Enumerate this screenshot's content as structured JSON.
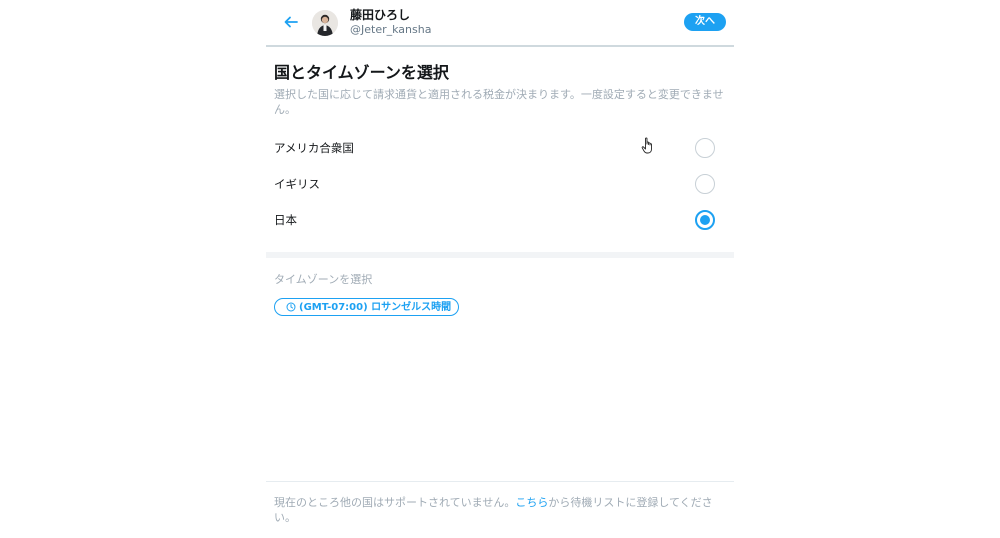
{
  "header": {
    "user_name": "藤田ひろし",
    "user_handle": "@Jeter_kansha",
    "next_label": "次へ"
  },
  "main": {
    "title": "国とタイムゾーンを選択",
    "description": "選択した国に応じて請求通貨と適用される税金が決まります。一度設定すると変更できません。",
    "countries": [
      {
        "label": "アメリカ合衆国",
        "selected": false
      },
      {
        "label": "イギリス",
        "selected": false
      },
      {
        "label": "日本",
        "selected": true
      }
    ]
  },
  "timezone": {
    "label": "タイムゾーンを選択",
    "selected": "(GMT-07:00) ロサンゼルス時間"
  },
  "footer": {
    "text_before": "現在のところ他の国はサポートされていません。",
    "link": "こちら",
    "text_after": "から待機リストに登録してください。"
  },
  "colors": {
    "accent": "#1da1f2",
    "muted_text": "#a0abb5",
    "primary_text": "#14171a"
  },
  "icons": [
    "back-arrow-icon",
    "clock-icon",
    "chevron-down-icon",
    "pointer-hand-cursor"
  ]
}
